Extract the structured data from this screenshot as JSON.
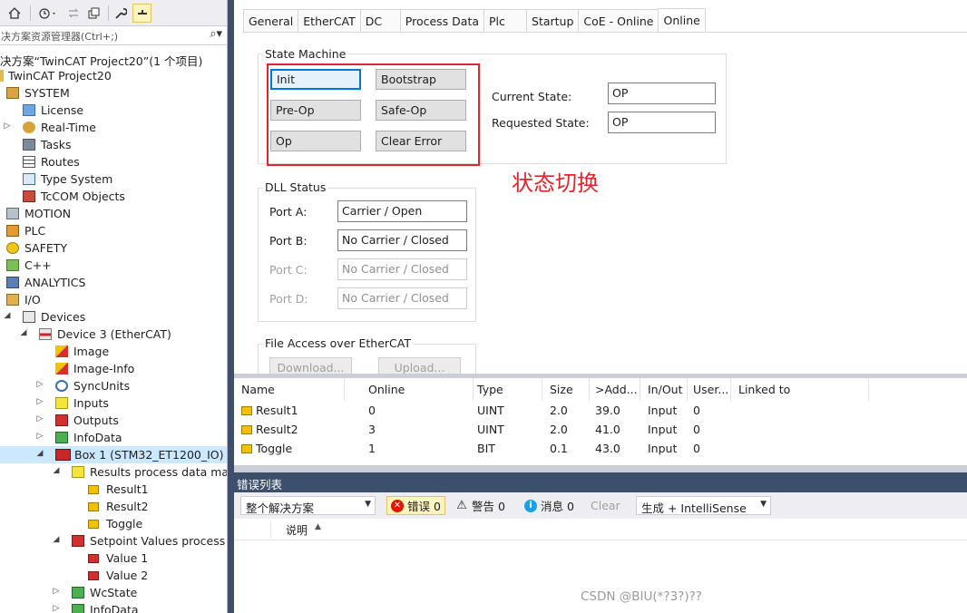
{
  "toolbar": {
    "home_icon": "home-icon",
    "history_icon": "clock-icon",
    "sync_icon": "sync-arrows-icon",
    "collapse_icon": "collapse-all-icon",
    "props_icon": "wrench-icon",
    "pin_icon": "pin-icon"
  },
  "search": {
    "placeholder": "决方案资源管理器(Ctrl+;)",
    "icon": "search-icon"
  },
  "tree": {
    "solution": "决方案“TwinCAT Project20”(1 个项目)",
    "project": "TwinCAT Project20",
    "system": "SYSTEM",
    "license": "License",
    "realtime": "Real-Time",
    "tasks": "Tasks",
    "routes": "Routes",
    "typesystem": "Type System",
    "tccom": "TcCOM Objects",
    "motion": "MOTION",
    "plc": "PLC",
    "safety": "SAFETY",
    "cpp": "C++",
    "analytics": "ANALYTICS",
    "io": "I/O",
    "devices": "Devices",
    "device3": "Device 3 (EtherCAT)",
    "image": "Image",
    "imageinfo": "Image-Info",
    "syncunits": "SyncUnits",
    "inputs": "Inputs",
    "outputs": "Outputs",
    "infodata": "InfoData",
    "box1": "Box 1 (STM32_ET1200_IO)",
    "results": "Results process data mapping",
    "result1": "Result1",
    "result2": "Result2",
    "toggle": "Toggle",
    "setpoint": "Setpoint Values process data mapping",
    "value1": "Value 1",
    "value2": "Value 2",
    "wcstate": "WcState",
    "infodata2": "InfoData"
  },
  "tabs": [
    "General",
    "EtherCAT",
    "DC",
    "Process Data",
    "Plc",
    "Startup",
    "CoE - Online",
    "Online"
  ],
  "state_machine": {
    "title": "State Machine",
    "init": "Init",
    "bootstrap": "Bootstrap",
    "preop": "Pre-Op",
    "safeop": "Safe-Op",
    "op": "Op",
    "clearerror": "Clear Error",
    "current_label": "Current State:",
    "current_value": "OP",
    "requested_label": "Requested State:",
    "requested_value": "OP"
  },
  "annotation": "状态切换",
  "dll": {
    "title": "DLL Status",
    "porta_label": "Port A:",
    "porta_value": "Carrier / Open",
    "portb_label": "Port B:",
    "portb_value": "No Carrier / Closed",
    "portc_label": "Port C:",
    "portc_value": "No Carrier / Closed",
    "portd_label": "Port D:",
    "portd_value": "No Carrier / Closed"
  },
  "file_access": {
    "title": "File Access over EtherCAT",
    "download": "Download...",
    "upload": "Upload..."
  },
  "var_table": {
    "columns": [
      "Name",
      "Online",
      "Type",
      "Size",
      ">Add...",
      "In/Out",
      "User...",
      "Linked to"
    ],
    "rows": [
      [
        "Result1",
        "0",
        "UINT",
        "2.0",
        "39.0",
        "Input",
        "0"
      ],
      [
        "Result2",
        "3",
        "UINT",
        "2.0",
        "41.0",
        "Input",
        "0"
      ],
      [
        "Toggle",
        "1",
        "BIT",
        "0.1",
        "43.0",
        "Input",
        "0"
      ]
    ]
  },
  "error_list": {
    "title": "错误列表",
    "scope": "整个解决方案",
    "errors": "错误 0",
    "warnings": "警告 0",
    "messages": "消息 0",
    "clear": "Clear",
    "build": "生成 + IntelliSense",
    "col_desc": "说明"
  },
  "watermark": "CSDN @BIU(*?3?)??",
  "colors": {
    "accent": "#0078d7",
    "annotation_red": "#e2252d",
    "panel_header": "#3e4f6e"
  }
}
